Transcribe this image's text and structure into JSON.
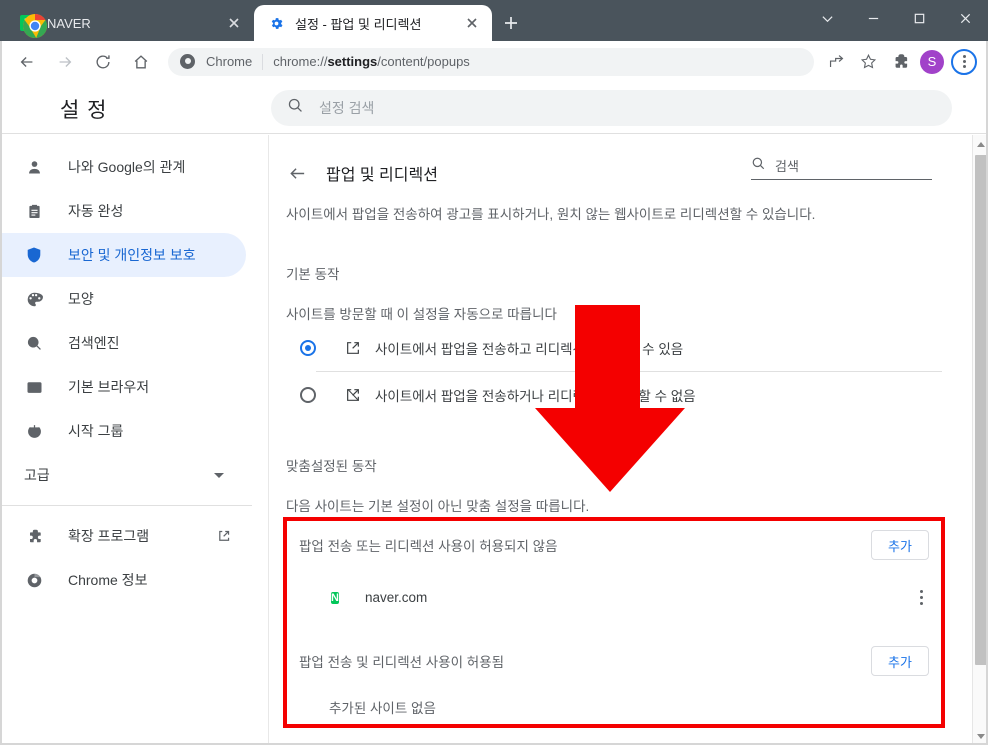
{
  "window": {
    "controls": {
      "tab_search_label": "tab-search",
      "minimize_label": "minimize",
      "maximize_label": "maximize",
      "close_label": "close"
    }
  },
  "tabs": [
    {
      "title": "NAVER",
      "favicon": "naver-favicon",
      "active": false
    },
    {
      "title": "설정 - 팝업 및 리디렉션",
      "favicon": "settings-gear-favicon",
      "active": true
    }
  ],
  "newtab": {
    "label": "+"
  },
  "toolbar": {
    "back_label": "back",
    "forward_label": "forward",
    "reload_label": "reload",
    "home_label": "home",
    "omnibox": {
      "scheme_text": "Chrome",
      "url_prefix": "chrome://",
      "url_bold": "settings",
      "url_suffix": "/content/popups",
      "full_url": "chrome://settings/content/popups"
    },
    "share_label": "share",
    "bookmark_label": "bookmark",
    "extensions_label": "extensions",
    "profile_initial": "S",
    "profile_color": "#a142c9",
    "menu_label": "chrome-menu"
  },
  "settings_header": {
    "title": "설 정",
    "search_placeholder": "설정 검색"
  },
  "sidebar": {
    "items": [
      {
        "label": "나와 Google의 관계",
        "icon": "person-icon",
        "active": false
      },
      {
        "label": "자동 완성",
        "icon": "clipboard-icon",
        "active": false
      },
      {
        "label": "보안 및 개인정보 보호",
        "icon": "shield-icon",
        "active": true
      },
      {
        "label": "모양",
        "icon": "palette-icon",
        "active": false
      },
      {
        "label": "검색엔진",
        "icon": "search-icon",
        "active": false
      },
      {
        "label": "기본 브라우저",
        "icon": "browser-window-icon",
        "active": false
      },
      {
        "label": "시작 그룹",
        "icon": "power-icon",
        "active": false
      }
    ],
    "advanced": {
      "label": "고급",
      "icon": "chevron-down-icon"
    },
    "footer_items": [
      {
        "label": "확장 프로그램",
        "icon": "puzzle-icon",
        "external": true
      },
      {
        "label": "Chrome 정보",
        "icon": "chrome-icon",
        "external": false
      }
    ]
  },
  "main": {
    "back_label": "back-arrow",
    "title": "팝업 및 리디렉션",
    "search_placeholder": "검색",
    "description": "사이트에서 팝업을 전송하여 광고를 표시하거나, 원치 않는 웹사이트로 리디렉션할 수 있습니다.",
    "default_behavior": {
      "heading": "기본 동작",
      "subtext": "사이트를 방문할 때 이 설정을 자동으로 따릅니다",
      "options": [
        {
          "label": "사이트에서 팝업을 전송하고 리디렉션을 사용할 수 있음",
          "icon": "popup-allow-icon",
          "selected": true
        },
        {
          "label": "사이트에서 팝업을 전송하거나 리디렉션을 사용할 수 없음",
          "icon": "popup-block-icon",
          "selected": false
        }
      ]
    },
    "custom_behavior": {
      "heading": "맞춤설정된 동작",
      "subtext": "다음 사이트는 기본 설정이 아닌 맞춤 설정을 따릅니다.",
      "groups": [
        {
          "label": "팝업 전송 또는 리디렉션 사용이 허용되지 않음",
          "add_button": "추가",
          "sites": [
            {
              "name": "naver.com",
              "favicon": "naver-favicon",
              "menu": "more-options-icon"
            }
          ],
          "empty_text": null
        },
        {
          "label": "팝업 전송 및 리디렉션 사용이 허용됨",
          "add_button": "추가",
          "sites": [],
          "empty_text": "추가된 사이트 없음"
        }
      ]
    }
  },
  "annotations": {
    "arrow_color": "#f40000",
    "highlight_box_color": "#f40000"
  },
  "scrollbar": {
    "up_label": "scroll-up",
    "down_label": "scroll-down"
  },
  "colors": {
    "accent": "#1a73e8",
    "active_sidebar_bg": "#e8f0fe",
    "tabstrip_bg": "#4a545c",
    "naver_green": "#03c75a"
  }
}
